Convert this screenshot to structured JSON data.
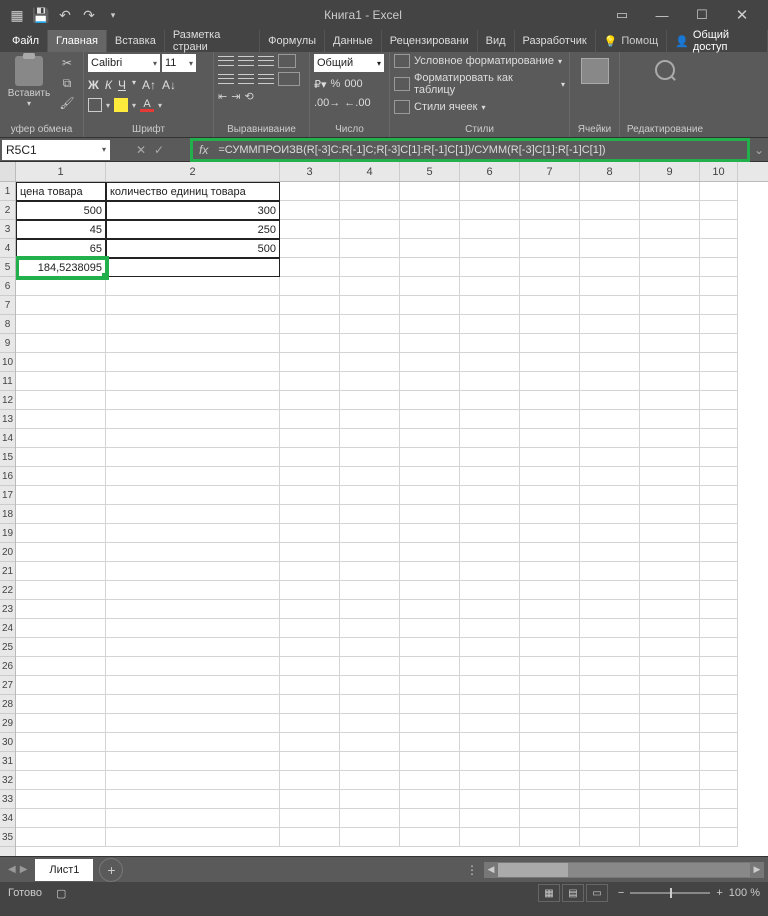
{
  "title": "Книга1 - Excel",
  "menu": {
    "file": "Файл",
    "tabs": [
      "Главная",
      "Вставка",
      "Разметка страни",
      "Формулы",
      "Данные",
      "Рецензировани",
      "Вид",
      "Разработчик"
    ],
    "active": 0,
    "help": "Помощ",
    "share": "Общий доступ"
  },
  "ribbon": {
    "clipboard": {
      "paste": "Вставить",
      "label": "уфер обмена"
    },
    "font": {
      "name": "Calibri",
      "size": "11",
      "label": "Шрифт",
      "bold": "Ж",
      "italic": "К",
      "underline": "Ч",
      "a": "A"
    },
    "align": {
      "label": "Выравнивание"
    },
    "number": {
      "format": "Общий",
      "label": "Число",
      "pct": "%",
      "comma": "000"
    },
    "styles": {
      "cond": "Условное форматирование",
      "table": "Форматировать как таблицу",
      "cell": "Стили ячеек",
      "label": "Стили"
    },
    "cells": {
      "label": "Ячейки"
    },
    "editing": {
      "label": "Редактирование"
    }
  },
  "namebox": "R5C1",
  "formula": "=СУММПРОИЗВ(R[-3]C:R[-1]C;R[-3]C[1]:R[-1]C[1])/СУММ(R[-3]C[1]:R[-1]C[1])",
  "fx": "fx",
  "columns": [
    "1",
    "2",
    "3",
    "4",
    "5",
    "6",
    "7",
    "8",
    "9",
    "10"
  ],
  "data": {
    "r1c1": "цена товара",
    "r1c2": "количество единиц товара",
    "r2c1": "500",
    "r2c2": "300",
    "r3c1": "45",
    "r3c2": "250",
    "r4c1": "65",
    "r4c2": "500",
    "r5c1": "184,5238095"
  },
  "sheet": {
    "name": "Лист1"
  },
  "status": {
    "ready": "Готово",
    "zoom": "100 %"
  }
}
